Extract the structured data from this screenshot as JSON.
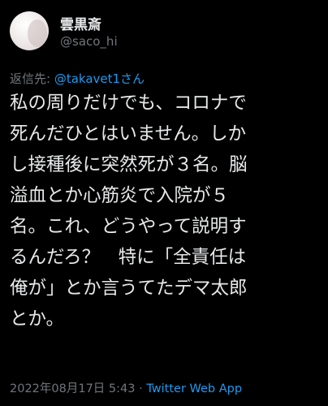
{
  "author": {
    "display_name": "雲黒斎",
    "handle": "@saco_hi",
    "avatar": "avatar-image"
  },
  "reply_to": {
    "label": "返信先: ",
    "mention": "@takavet1さん"
  },
  "tweet": {
    "lines": [
      "私の周りだけでも、コロナで",
      "死んだひとはいません。しか",
      "し接種後に突然死が３名。脳",
      "溢血とか心筋炎で入院が５",
      "名。これ、どうやって説明す",
      "るんだろ？　特に「全責任は",
      "俺が」とか言うてたデマ太郎",
      "とか。"
    ]
  },
  "meta": {
    "timestamp": "2022年08月17日 5:43",
    "separator": " · ",
    "source": "Twitter Web App"
  },
  "colors": {
    "background": "#000000",
    "text": "#e7e9ea",
    "secondary": "#71767b",
    "link": "#1d9bf0"
  }
}
